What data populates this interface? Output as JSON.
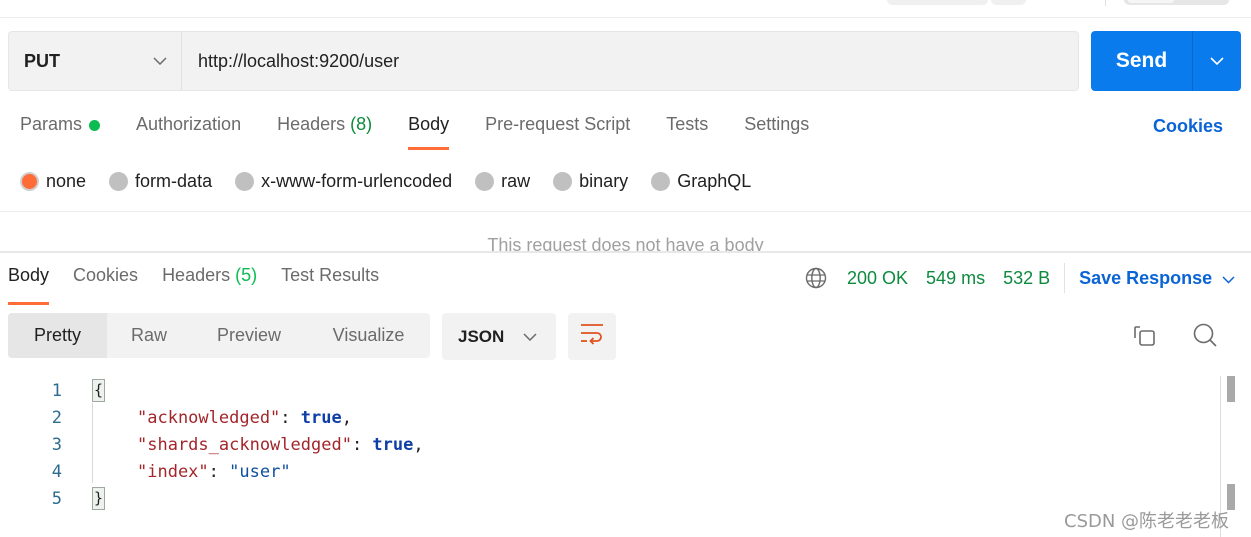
{
  "request": {
    "method": "PUT",
    "url": "http://localhost:9200/user",
    "send_label": "Send",
    "tabs": [
      {
        "label": "Params",
        "has_dot": true
      },
      {
        "label": "Authorization"
      },
      {
        "label": "Headers",
        "count": "(8)"
      },
      {
        "label": "Body",
        "active": true
      },
      {
        "label": "Pre-request Script"
      },
      {
        "label": "Tests"
      },
      {
        "label": "Settings"
      }
    ],
    "cookies_label": "Cookies",
    "body_types": [
      {
        "label": "none",
        "selected": true
      },
      {
        "label": "form-data"
      },
      {
        "label": "x-www-form-urlencoded"
      },
      {
        "label": "raw"
      },
      {
        "label": "binary"
      },
      {
        "label": "GraphQL"
      }
    ],
    "no_body_message": "This request does not have a body"
  },
  "response": {
    "tabs": [
      {
        "label": "Body",
        "active": true
      },
      {
        "label": "Cookies"
      },
      {
        "label": "Headers",
        "count": "(5)"
      },
      {
        "label": "Test Results"
      }
    ],
    "status": "200 OK",
    "time": "549 ms",
    "size": "532 B",
    "save_label": "Save Response",
    "view_modes": [
      "Pretty",
      "Raw",
      "Preview",
      "Visualize"
    ],
    "active_view": "Pretty",
    "language": "JSON",
    "body_lines": [
      {
        "num": "1"
      },
      {
        "num": "2",
        "key": "\"acknowledged\"",
        "value": "true",
        "value_type": "bool",
        "trailing": ","
      },
      {
        "num": "3",
        "key": "\"shards_acknowledged\"",
        "value": "true",
        "value_type": "bool",
        "trailing": ","
      },
      {
        "num": "4",
        "key": "\"index\"",
        "value": "\"user\"",
        "value_type": "string",
        "trailing": ""
      },
      {
        "num": "5"
      }
    ],
    "open_brace": "{",
    "close_brace": "}"
  },
  "colors": {
    "accent_orange": "#ff6c37",
    "send_blue": "#097bed",
    "link_blue": "#0b64d5",
    "status_green": "#0e8a3f"
  },
  "watermark": "CSDN @陈老老老板"
}
